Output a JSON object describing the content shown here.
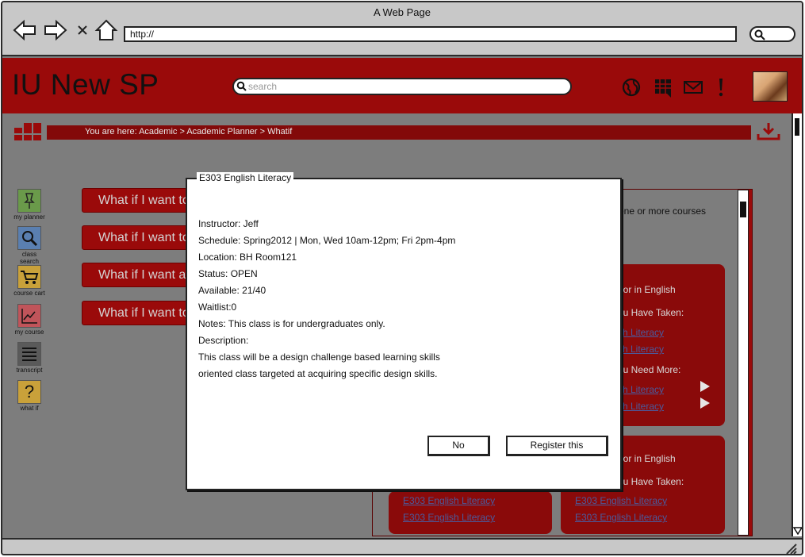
{
  "browser": {
    "window_title": "A Web Page",
    "url": "http://"
  },
  "app": {
    "logo": "IU New SP",
    "search_placeholder": "search",
    "breadcrumb": "You are here: Academic > Academic Planner > Whatif"
  },
  "sidebar": {
    "items": [
      {
        "label": "my planner",
        "icon": "pin-icon",
        "color": "#6a9a4a"
      },
      {
        "label": "class search",
        "icon": "magnifier-icon",
        "color": "#5a7fb0"
      },
      {
        "label": "course cart",
        "icon": "cart-icon",
        "color": "#c9a13a"
      },
      {
        "label": "my course",
        "icon": "chart-icon",
        "color": "#c0545a"
      },
      {
        "label": "transcript",
        "icon": "list-icon",
        "color": "#5a5a5a"
      },
      {
        "label": "what if",
        "icon": "question-icon",
        "color": "#c9a13a"
      }
    ]
  },
  "whatif_buttons": [
    {
      "label": "What if I want to"
    },
    {
      "label": "What if I want to"
    },
    {
      "label": "What if I want a"
    },
    {
      "label": "What if I want to"
    }
  ],
  "right_panel": {
    "intro": "one or more courses",
    "cards": [
      {
        "title": "nor in English",
        "taken_label": "ou Have Taken:",
        "taken": [
          "sh Literacy",
          "sh Literacy"
        ],
        "need_label": "ou Need More:",
        "need": [
          "sh Literacy",
          "sh Literacy"
        ]
      },
      {
        "title": "nor in English",
        "taken_label": "ou Have Taken:",
        "taken": [
          "E303 English Literacy",
          "E303 English Literacy"
        ]
      }
    ],
    "left_card_links": [
      "E303 English Literacy",
      "E303 English Literacy"
    ]
  },
  "modal": {
    "title": "E303 English Literacy",
    "lines": [
      "Instructor: Jeff",
      "Schedule: Spring2012 | Mon, Wed 10am-12pm; Fri 2pm-4pm",
      "Location: BH Room121",
      "Status: OPEN",
      "Available: 21/40",
      "Waitlist:0",
      "Notes: This class is for undergraduates only.",
      "Description:",
      "This class will be a design challenge based learning skills",
      "oriented class targeted at acquiring specific design skills."
    ],
    "no_label": "No",
    "register_label": "Register this"
  },
  "colors": {
    "brand": "#9a0a0a",
    "overlay": "#7d7d7d"
  }
}
